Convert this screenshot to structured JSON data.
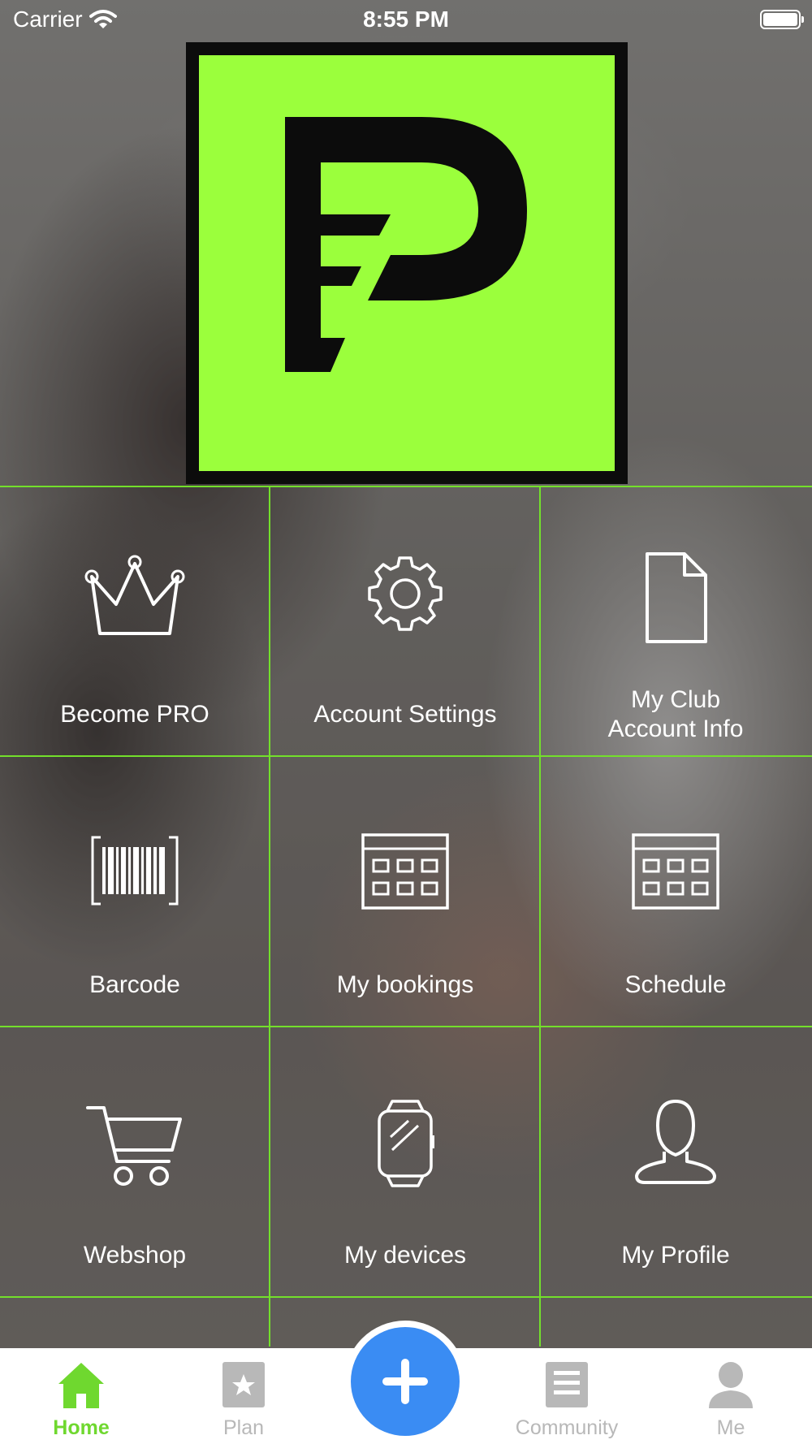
{
  "status_bar": {
    "carrier": "Carrier",
    "time": "8:55 PM",
    "wifi_icon": "wifi-icon",
    "battery_icon": "battery-icon"
  },
  "logo": {
    "brand_color": "#9bff3c",
    "frame_color": "#0c0c0c",
    "icon": "fp-logo"
  },
  "grid": {
    "line_color": "#73e02b",
    "tiles": [
      {
        "label": "Become PRO",
        "icon": "crown-icon"
      },
      {
        "label": "Account Settings",
        "icon": "gear-icon"
      },
      {
        "label_line1": "My Club",
        "label_line2": "Account Info",
        "icon": "document-icon"
      },
      {
        "label": "Barcode",
        "icon": "barcode-icon"
      },
      {
        "label": "My bookings",
        "icon": "calendar-icon"
      },
      {
        "label": "Schedule",
        "icon": "calendar-icon"
      },
      {
        "label": "Webshop",
        "icon": "cart-icon"
      },
      {
        "label": "My devices",
        "icon": "smartwatch-icon"
      },
      {
        "label": "My Profile",
        "icon": "user-profile-icon"
      }
    ]
  },
  "tab_bar": {
    "active_color": "#6fd82f",
    "inactive_color": "#b8b8b8",
    "fab_color": "#3a8cf3",
    "tabs": [
      {
        "label": "Home",
        "icon": "home-icon",
        "active": true
      },
      {
        "label": "Plan",
        "icon": "star-square-icon",
        "active": false
      },
      {
        "label": "Community",
        "icon": "document-list-icon",
        "active": false
      },
      {
        "label": "Me",
        "icon": "person-icon",
        "active": false
      }
    ],
    "fab_icon": "plus-icon"
  }
}
